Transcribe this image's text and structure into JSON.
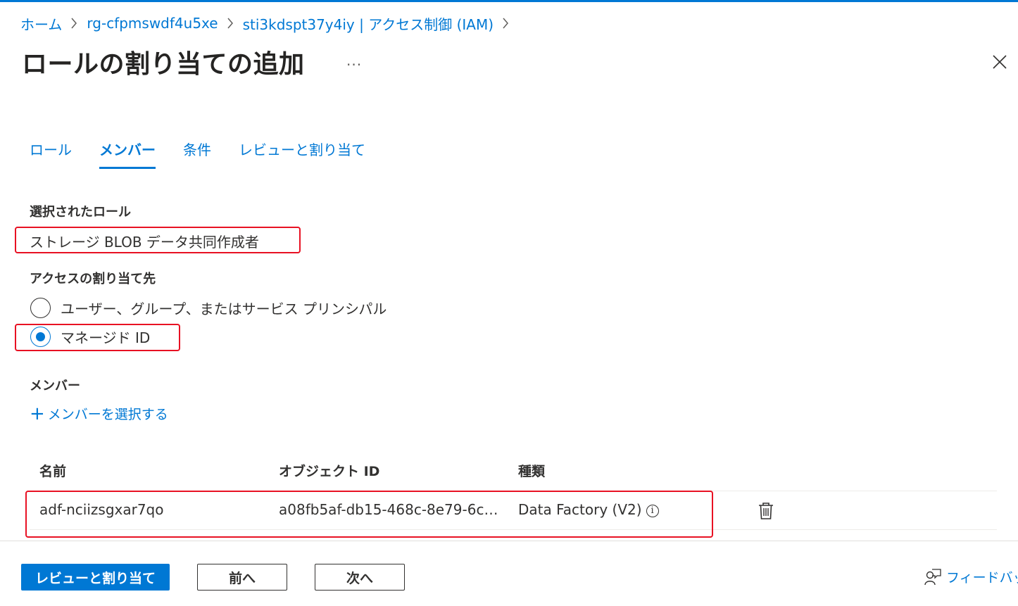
{
  "breadcrumb": [
    {
      "label": "ホーム"
    },
    {
      "label": "rg-cfpmswdf4u5xe"
    },
    {
      "label": "sti3kdspt37y4iy | アクセス制御 (IAM)"
    }
  ],
  "header": {
    "title": "ロールの割り当ての追加",
    "more": "...",
    "close_icon": "close-icon"
  },
  "tabs": [
    {
      "label": "ロール",
      "active": false
    },
    {
      "label": "メンバー",
      "active": true
    },
    {
      "label": "条件",
      "active": false
    },
    {
      "label": "レビューと割り当て",
      "active": false
    }
  ],
  "selected_role": {
    "label": "選択されたロール",
    "value": "ストレージ BLOB データ共同作成者"
  },
  "assign_access": {
    "label": "アクセスの割り当て先",
    "options": [
      {
        "label": "ユーザー、グループ、またはサービス プリンシパル",
        "checked": false
      },
      {
        "label": "マネージド ID",
        "checked": true
      }
    ]
  },
  "members": {
    "label": "メンバー",
    "add_link": "メンバーを選択する",
    "columns": [
      "名前",
      "オブジェクト ID",
      "種類"
    ],
    "rows": [
      {
        "name": "adf-nciizsgxar7qo",
        "object_id": "a08fb5af-db15-468c-8e79-6c…",
        "type": "Data Factory (V2)"
      }
    ]
  },
  "footer": {
    "review_button": "レビューと割り当て",
    "prev_button": "前へ",
    "next_button": "次へ",
    "feedback": "フィードバック"
  },
  "colors": {
    "accent": "#0078d4",
    "highlight": "#e81123"
  }
}
